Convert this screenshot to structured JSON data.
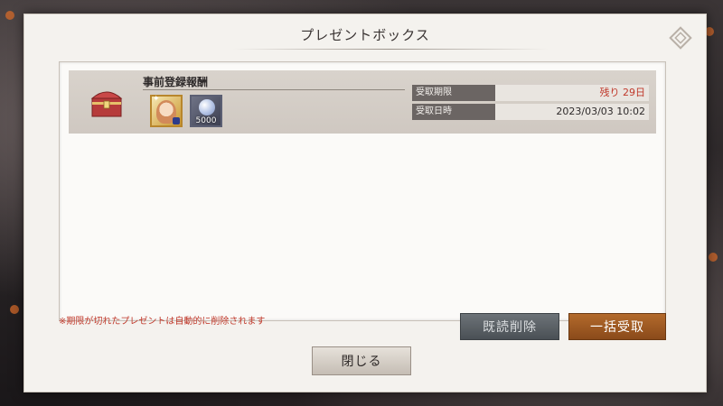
{
  "dialog": {
    "title": "プレゼントボックス"
  },
  "item": {
    "title": "事前登録報酬",
    "rewards": [
      {
        "name": "character-card",
        "quantity": ""
      },
      {
        "name": "crystal-orb",
        "quantity": "5000"
      }
    ],
    "expiry_label": "受取期限",
    "expiry_value": "残り 29日",
    "date_label": "受取日時",
    "date_value": "2023/03/03 10:02"
  },
  "notice": "※期限が切れたプレゼントは自動的に削除されます",
  "buttons": {
    "delete_read": "既読削除",
    "receive_all": "一括受取",
    "close": "閉じる"
  },
  "colors": {
    "accent": "#b36a2c",
    "warning": "#c0392b"
  }
}
